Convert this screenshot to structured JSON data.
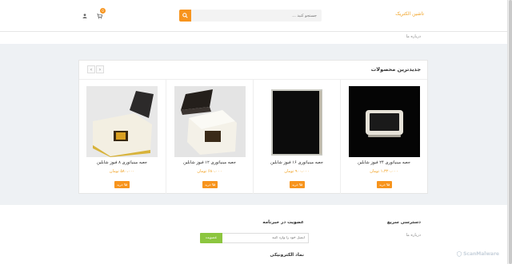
{
  "header": {
    "logo_alt": "تاشین الکتریک",
    "search_placeholder": "جستجو کنید ...",
    "cart_count": "0"
  },
  "breadcrumb": "درباره ما",
  "panel": {
    "title": "جدیدترین محصولات",
    "prev": "‹",
    "next": "›"
  },
  "products": [
    {
      "name": "جعبه مینیاتوری ۲۴ فیوز شابلین",
      "price": "۱،۳۲۰،۰۰۰ تومان",
      "buy": "خرید",
      "image": "white-tray-black-background"
    },
    {
      "name": "جعبه مینیاتوری ۱۶ فیوز شابلین",
      "price": "۹۰۰،۰۰۰ تومان",
      "buy": "خرید",
      "image": "black-door-panel"
    },
    {
      "name": "جعبه مینیاتوری ۱۲ فیوز شابلین",
      "price": "۶۸۰،۰۰۰ تومان",
      "buy": "خرید",
      "image": "white-box-dark-lid"
    },
    {
      "name": "جعبه مینیاتوری ۸ فیوز شابلین",
      "price": "۵۸۰،۰۰۰ تومان",
      "buy": "خرید",
      "image": "white-box-dark-lid-yellow-base"
    }
  ],
  "footer": {
    "quick_access_title": "دسترسی سریع",
    "quick_access_link": "درباره ما",
    "newsletter_title": "عضویت در خبرنامه",
    "newsletter_placeholder": "ایمیل خود را وارد کنید",
    "newsletter_button": "عضویت",
    "trust_title": "نماد الکترونیکی"
  },
  "watermark": "ScanMalware",
  "colors": {
    "accent": "#f7941d",
    "price": "#f0a020",
    "subscribe": "#8cc63f",
    "background": "#eef1f4"
  }
}
